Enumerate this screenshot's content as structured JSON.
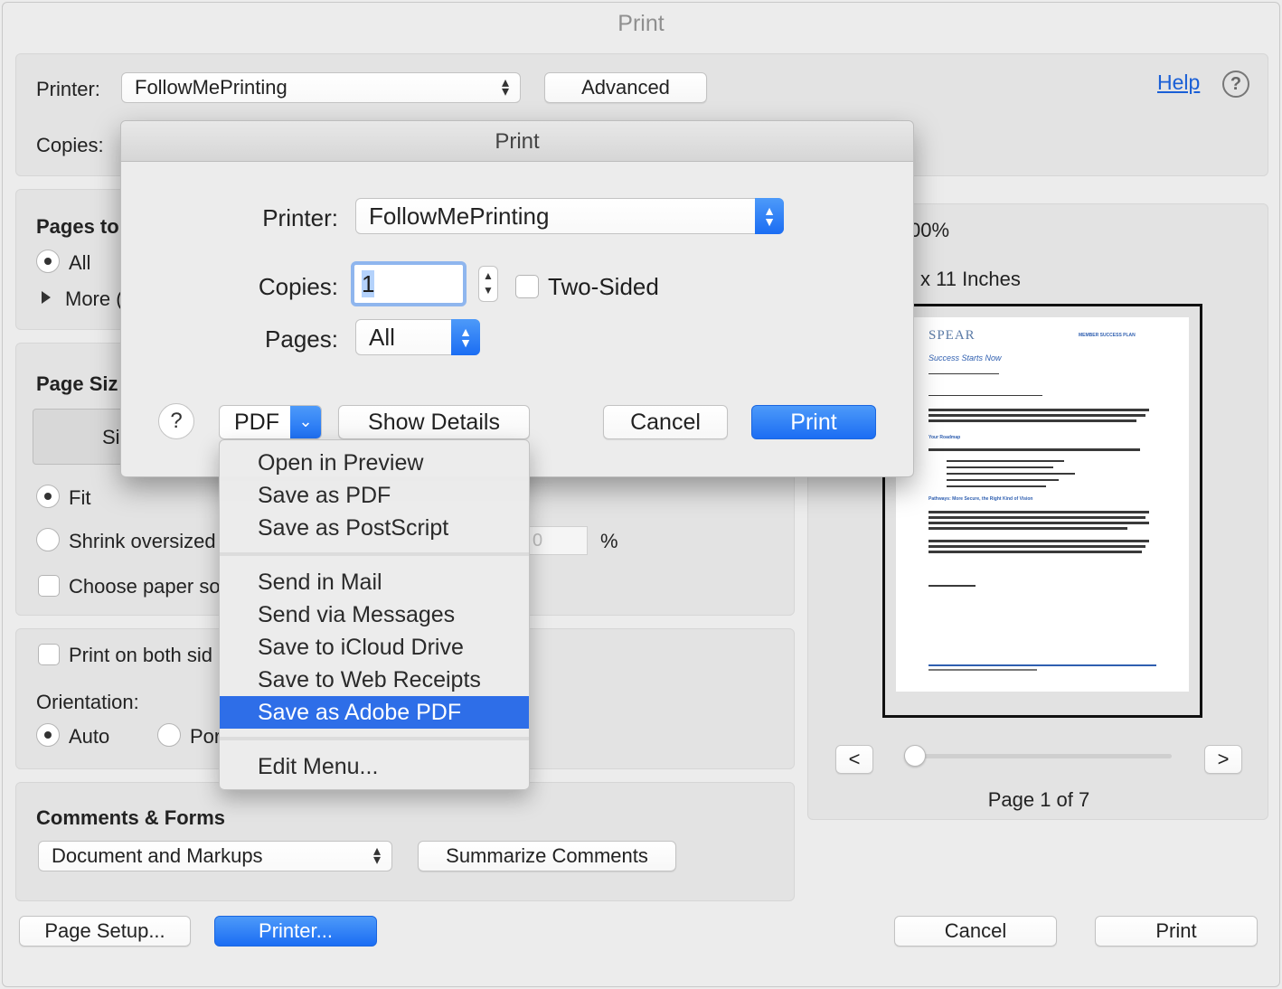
{
  "window": {
    "title": "Print"
  },
  "top": {
    "printer_label": "Printer:",
    "printer_value": "FollowMePrinting",
    "advanced_label": "Advanced",
    "copies_label": "Copies:",
    "help_label": "Help",
    "help_icon": "question-circle-icon"
  },
  "pages_to_print": {
    "heading": "Pages to",
    "all": "All",
    "more": "More ("
  },
  "page_sizing": {
    "heading": "Page Siz",
    "size_tab": "Si",
    "fit": "Fit",
    "shrink": "Shrink oversized",
    "choose_paper": "Choose paper so",
    "percent_value": "0",
    "percent_sign": "%"
  },
  "orientation": {
    "both_sides": "Print on both sid",
    "label": "Orientation:",
    "auto": "Auto",
    "portrait": "Por"
  },
  "comments": {
    "heading": "Comments & Forms",
    "select_value": "Document and Markups",
    "summarize": "Summarize Comments"
  },
  "preview": {
    "scale": "00%",
    "size": "x 11 Inches",
    "page_label": "Page 1 of 7",
    "prev": "<",
    "next": ">",
    "doc": {
      "logo": "SPEAR",
      "header_right": "MEMBER SUCCESS PLAN",
      "tagline": "Success Starts Now",
      "heading2": "Your Roadmap",
      "heading3": "Pathways: More Secure, the Right Kind of Vision"
    }
  },
  "footer": {
    "page_setup": "Page Setup...",
    "printer": "Printer...",
    "cancel": "Cancel",
    "print": "Print"
  },
  "dialog": {
    "title": "Print",
    "printer_label": "Printer:",
    "printer_value": "FollowMePrinting",
    "copies_label": "Copies:",
    "copies_value": "1",
    "two_sided": "Two-Sided",
    "pages_label": "Pages:",
    "pages_value": "All",
    "help": "?",
    "pdf": "PDF",
    "show_details": "Show Details",
    "cancel": "Cancel",
    "print": "Print"
  },
  "pdf_menu": {
    "items": [
      "Open in Preview",
      "Save as PDF",
      "Save as PostScript",
      "Send in Mail",
      "Send via Messages",
      "Save to iCloud Drive",
      "Save to Web Receipts",
      "Save as Adobe PDF",
      "Edit Menu..."
    ],
    "highlighted": "Save as Adobe PDF"
  },
  "colors": {
    "accent": "#1b6df3",
    "highlight": "#2e6ee8",
    "link": "#1a5fd6"
  }
}
